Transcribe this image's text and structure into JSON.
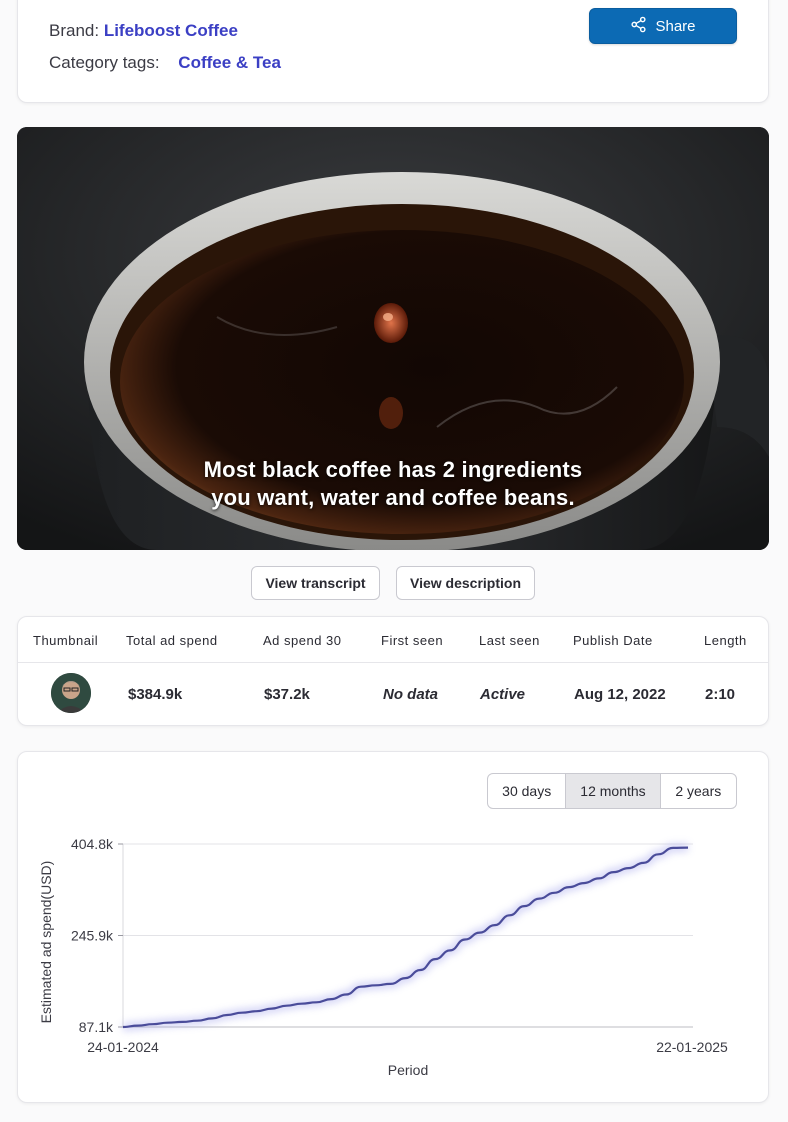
{
  "header": {
    "brand_label": "Brand:",
    "brand_value": "Lifeboost Coffee",
    "category_label": "Category tags:",
    "category_value": "Coffee & Tea",
    "share_label": "Share"
  },
  "video": {
    "caption_line1": "Most black coffee has 2 ingredients",
    "caption_line2": "you want, water and coffee beans."
  },
  "actions": {
    "transcript_label": "View transcript",
    "description_label": "View description"
  },
  "table": {
    "columns": [
      "Thumbnail",
      "Total ad spend",
      "Ad spend 30",
      "First seen",
      "Last seen",
      "Publish Date",
      "Length"
    ],
    "row": {
      "total_ad_spend": "$384.9k",
      "ad_spend_30": "$37.2k",
      "first_seen": "No data",
      "last_seen": "Active",
      "publish_date": "Aug 12, 2022",
      "length": "2:10"
    }
  },
  "chart": {
    "ranges": [
      "30 days",
      "12 months",
      "2 years"
    ],
    "selected_range": "12 months"
  },
  "colors": {
    "accent_link": "#3b3fc4",
    "share_button": "#0c6ab4",
    "line": "#4a4c9a"
  },
  "chart_data": {
    "type": "line",
    "xlabel": "Period",
    "ylabel": "Estimated ad spend(USD)",
    "x_tick_labels": [
      "24-01-2024",
      "22-01-2025"
    ],
    "y_tick_labels": [
      "87.1k",
      "245.9k",
      "404.8k"
    ],
    "ylim": [
      87100,
      404800
    ],
    "grid": "horizontal",
    "series": [
      {
        "values": [
          87100,
          89500,
          92000,
          94500,
          96000,
          98000,
          102000,
          108000,
          112000,
          114500,
          119000,
          124000,
          127500,
          130000,
          135500,
          143500,
          157000,
          159500,
          162000,
          172000,
          186000,
          205000,
          220000,
          239000,
          251000,
          264000,
          281000,
          297000,
          310000,
          320000,
          330000,
          337000,
          345000,
          356000,
          363000,
          372000,
          387000,
          398000,
          398500
        ]
      }
    ]
  }
}
